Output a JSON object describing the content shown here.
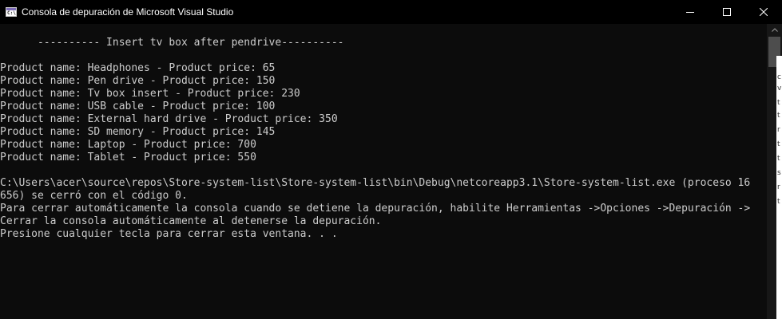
{
  "window": {
    "title": "Consola de depuración de Microsoft Visual Studio",
    "icon": "console-app-icon",
    "icon_glyph": "C:\\"
  },
  "controls": {
    "minimize_icon": "minimize-icon",
    "maximize_icon": "maximize-icon",
    "close_icon": "close-icon"
  },
  "console": {
    "header": "      ---------- Insert tv box after pendrive----------",
    "products": [
      "Product name: Headphones - Product price: 65",
      "Product name: Pen drive - Product price: 150",
      "Product name: Tv box insert - Product price: 230",
      "Product name: USB cable - Product price: 100",
      "Product name: External hard drive - Product price: 350",
      "Product name: SD memory - Product price: 145",
      "Product name: Laptop - Product price: 700",
      "Product name: Tablet - Product price: 550"
    ],
    "exit_lines": [
      "C:\\Users\\acer\\source\\repos\\Store-system-list\\Store-system-list\\bin\\Debug\\netcoreapp3.1\\Store-system-list.exe (proceso 16",
      "656) se cerró con el código 0.",
      "Para cerrar automáticamente la consola cuando se detiene la depuración, habilite Herramientas ->Opciones ->Depuración ->",
      "Cerrar la consola automáticamente al detenerse la depuración.",
      "Presione cualquier tecla para cerrar esta ventana. . ."
    ]
  },
  "background_window_glyphs": [
    "c",
    "v",
    "t",
    "t",
    "r",
    "t",
    "t",
    "s",
    "r",
    "t"
  ],
  "colors": {
    "console_bg": "#0c0c0c",
    "console_text": "#cccccc",
    "titlebar_bg": "#000000",
    "title_text": "#ffffff"
  }
}
